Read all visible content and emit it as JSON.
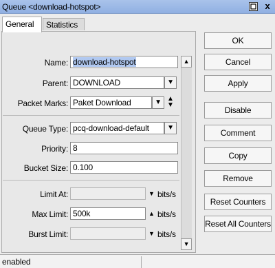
{
  "window": {
    "title": "Queue <download-hotspot>",
    "maximize_icon": "maximize-icon",
    "close_icon": "close-icon",
    "close_glyph": "x"
  },
  "tabs": [
    {
      "label": "General"
    },
    {
      "label": "Statistics"
    }
  ],
  "form": {
    "name": {
      "label": "Name:",
      "value": "download-hotspot"
    },
    "parent": {
      "label": "Parent:",
      "value": "DOWNLOAD"
    },
    "packet_marks": {
      "label": "Packet Marks:",
      "value": "Paket Download"
    },
    "queue_type": {
      "label": "Queue Type:",
      "value": "pcq-download-default"
    },
    "priority": {
      "label": "Priority:",
      "value": "8"
    },
    "bucket_size": {
      "label": "Bucket Size:",
      "value": "0.100"
    },
    "limit_at": {
      "label": "Limit At:",
      "value": "",
      "unit": "bits/s"
    },
    "max_limit": {
      "label": "Max Limit:",
      "value": "500k",
      "unit": "bits/s"
    },
    "burst_limit": {
      "label": "Burst Limit:",
      "value": "",
      "unit": "bits/s"
    }
  },
  "buttons": {
    "ok": "OK",
    "cancel": "Cancel",
    "apply": "Apply",
    "disable": "Disable",
    "comment": "Comment",
    "copy": "Copy",
    "remove": "Remove",
    "reset_counters": "Reset Counters",
    "reset_all_counters": "Reset All Counters"
  },
  "status": {
    "text": "enabled"
  }
}
